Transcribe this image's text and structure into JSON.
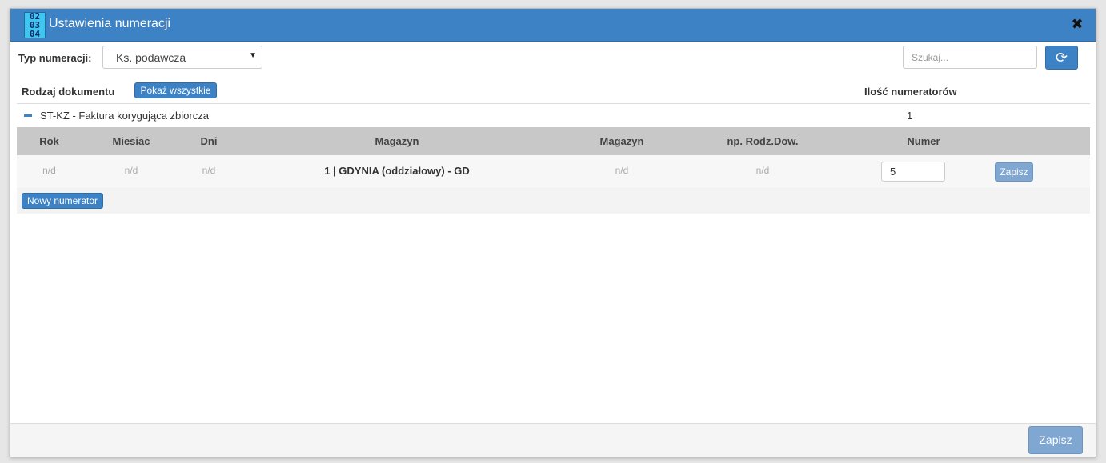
{
  "dialog": {
    "title": "Ustawienia numeracji",
    "icon": "numbering-icon",
    "icon_digits": [
      "02",
      "03",
      "04"
    ],
    "close_label": "✖"
  },
  "toolbar": {
    "type_label": "Typ numeracji:",
    "type_value": "Ks. podawcza",
    "search_placeholder": "Szukaj...",
    "refresh_icon": "refresh-icon"
  },
  "list": {
    "doc_type_label": "Rodzaj dokumentu",
    "show_all_label": "Pokaż wszystkie",
    "count_label": "Ilość numeratorów"
  },
  "group": {
    "name": "ST-KZ - Faktura korygująca zbiorcza",
    "count": "1"
  },
  "table": {
    "headers": {
      "rok": "Rok",
      "miesiac": "Miesiac",
      "dni": "Dni",
      "magazyn1": "Magazyn",
      "magazyn2": "Magazyn",
      "rodz": "np. Rodz.Dow.",
      "numer": "Numer"
    },
    "row": {
      "rok": "n/d",
      "miesiac": "n/d",
      "dni": "n/d",
      "magazyn1": "1 | GDYNIA (oddziałowy) - GD",
      "magazyn2": "n/d",
      "rodz": "n/d",
      "numer": "5",
      "save_label": "Zapisz"
    },
    "new_label": "Nowy numerator"
  },
  "footer": {
    "save_label": "Zapisz"
  },
  "colors": {
    "titlebar": "#3d82c4",
    "button_primary": "#3d82c4",
    "button_disabled": "#7fa7d1",
    "table_header": "#c8c8c8"
  }
}
